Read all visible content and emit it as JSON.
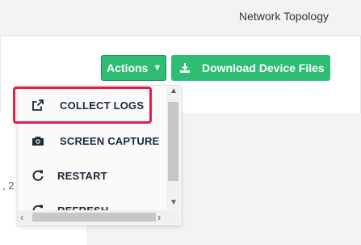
{
  "header": {
    "nav_link": "Network Topology"
  },
  "toolbar": {
    "actions_label": "Actions",
    "download_label": "Download Device Files"
  },
  "actions_menu": {
    "items": [
      {
        "label": "COLLECT LOGS",
        "icon": "external-link-icon"
      },
      {
        "label": "SCREEN CAPTURE",
        "icon": "camera-icon"
      },
      {
        "label": "RESTART",
        "icon": "restart-icon"
      },
      {
        "label": "REFRESH",
        "icon": "refresh-icon"
      }
    ]
  },
  "background": {
    "partial_text": ", 2"
  },
  "colors": {
    "accent_green": "#2ebd73",
    "highlight_red": "#e11d48",
    "menu_text": "#1c2a3a"
  }
}
